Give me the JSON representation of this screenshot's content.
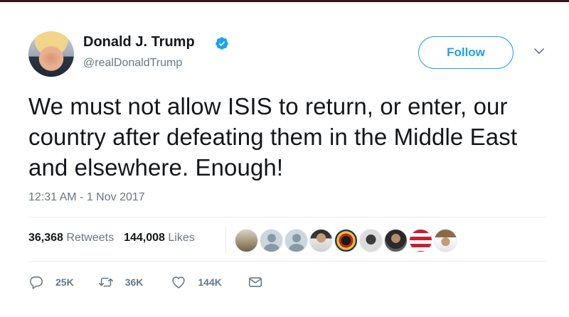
{
  "author": {
    "name": "Donald J. Trump",
    "handle": "@realDonaldTrump",
    "verified": true
  },
  "follow_button": {
    "label": "Follow"
  },
  "tweet": {
    "text": "We must not allow ISIS to return, or enter, our country after defeating them in the Middle East and elsewhere. Enough!",
    "timestamp": "12:31 AM - 1 Nov 2017"
  },
  "stats": {
    "retweets_count": "36,368",
    "retweets_label": "Retweets",
    "likes_count": "144,008",
    "likes_label": "Likes"
  },
  "actions": {
    "reply_count": "25K",
    "retweet_count": "36K",
    "like_count": "144K"
  },
  "colors": {
    "accent": "#1da1f2",
    "secondary_text": "#657786",
    "divider": "#e6ecf0",
    "top_bar": "#3a1416"
  }
}
